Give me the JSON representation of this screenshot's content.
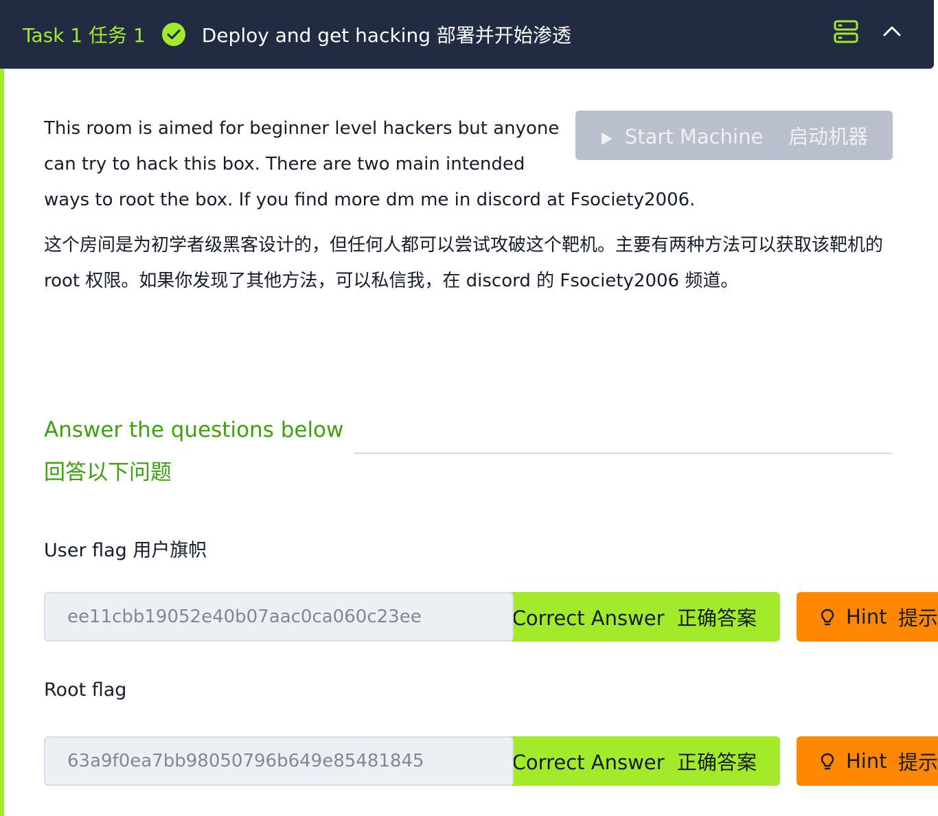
{
  "header": {
    "task_number": "Task 1  任务 1",
    "task_title": "Deploy and get hacking  部署并开始渗透",
    "colors": {
      "background": "#212c42",
      "accent": "#a3ea2a"
    }
  },
  "start_machine": {
    "label": "Start Machine    启动机器"
  },
  "description": {
    "english": "This room is aimed for beginner level hackers but anyone can try to hack this box. There are two main intended ways to root the box. If you find more dm me in discord at Fsociety2006.",
    "chinese": "这个房间是为初学者级黑客设计的，但任何人都可以尝试攻破这个靶机。主要有两种方法可以获取该靶机的 root 权限。如果你发现了其他方法，可以私信我，在 discord 的 Fsociety2006 频道。"
  },
  "questions_heading": {
    "english": "Answer the questions below",
    "chinese": "回答以下问题"
  },
  "questions": [
    {
      "label": "User flag  用户旗帜",
      "answer": "ee11cbb19052e40b07aac0ca060c23ee",
      "correct_label": "Correct Answer  正确答案",
      "hint_label": "Hint",
      "hint_cn": "提示"
    },
    {
      "label": "Root flag",
      "answer": "63a9f0ea7bb98050796b649e85481845",
      "correct_label": "Correct Answer  正确答案",
      "hint_label": "Hint",
      "hint_cn": "提示"
    }
  ],
  "colors": {
    "correct": "#a3ea2a",
    "hint": "#ff8800",
    "heading_green": "#3e9f0f",
    "disabled_button": "#b9bfcb"
  }
}
